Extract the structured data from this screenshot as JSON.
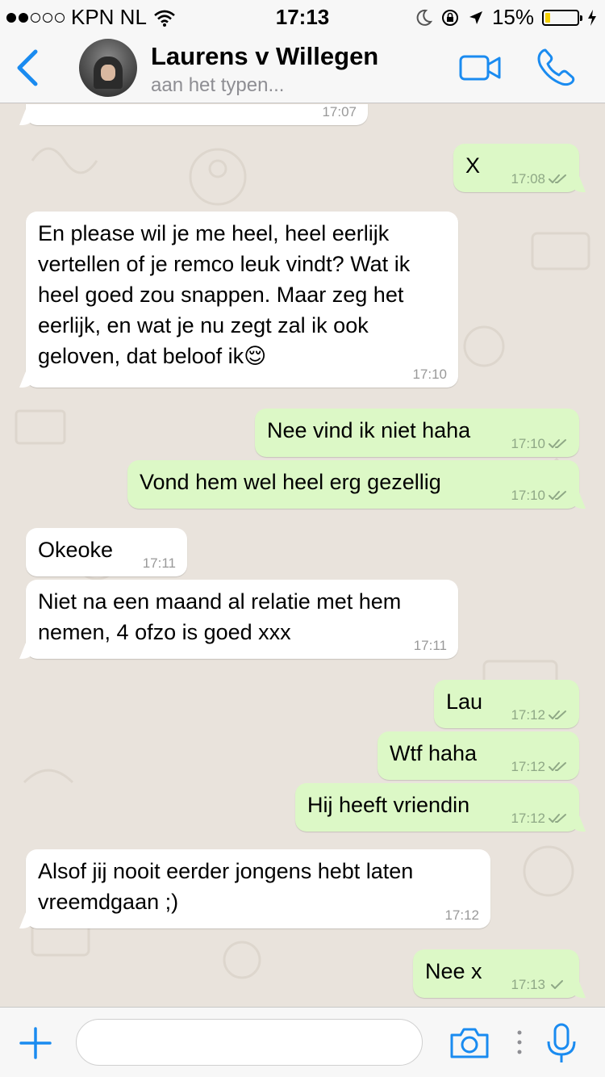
{
  "status_bar": {
    "carrier": "KPN NL",
    "time": "17:13",
    "battery": "15%",
    "battery_level": 0.15,
    "battery_color": "#f5d000"
  },
  "header": {
    "contact_name": "Laurens v Willegen",
    "contact_status": "aan het typen...",
    "icons": [
      "back-chevron-icon",
      "video-call-icon",
      "phone-icon"
    ],
    "accent_color": "#1a8bf0"
  },
  "messages": [
    {
      "dir": "in",
      "text": "",
      "time": "17:07"
    },
    {
      "dir": "out",
      "text": "X",
      "time": "17:08",
      "ticks": "double"
    },
    {
      "dir": "in",
      "text": "En please wil je me heel, heel eerlijk vertellen of je remco leuk vindt? Wat ik heel goed zou snappen. Maar zeg het eerlijk, en wat je nu zegt zal ik ook geloven, dat beloof ik😌",
      "time": "17:10"
    },
    {
      "dir": "out",
      "text": "Nee vind ik niet haha",
      "time": "17:10",
      "ticks": "double"
    },
    {
      "dir": "out",
      "text": "Vond hem wel heel erg gezellig",
      "time": "17:10",
      "ticks": "double"
    },
    {
      "dir": "in",
      "text": "Okeoke",
      "time": "17:11"
    },
    {
      "dir": "in",
      "text": "Niet na een maand al relatie met hem nemen, 4 ofzo is goed xxx",
      "time": "17:11"
    },
    {
      "dir": "out",
      "text": "Lau",
      "time": "17:12",
      "ticks": "double"
    },
    {
      "dir": "out",
      "text": "Wtf haha",
      "time": "17:12",
      "ticks": "double"
    },
    {
      "dir": "out",
      "text": "Hij heeft vriendin",
      "time": "17:12",
      "ticks": "double"
    },
    {
      "dir": "in",
      "text": "Alsof jij nooit eerder jongens hebt laten vreemdgaan ;)",
      "time": "17:12"
    },
    {
      "dir": "out",
      "text": "Nee x",
      "time": "17:13",
      "ticks": "single"
    }
  ],
  "input_bar": {
    "placeholder": "",
    "icons": [
      "plus-icon",
      "camera-icon",
      "more-icon",
      "microphone-icon"
    ]
  },
  "colors": {
    "incoming_bubble": "#ffffff",
    "outgoing_bubble": "#dcf8c6",
    "chat_background": "#e9e3dc"
  }
}
